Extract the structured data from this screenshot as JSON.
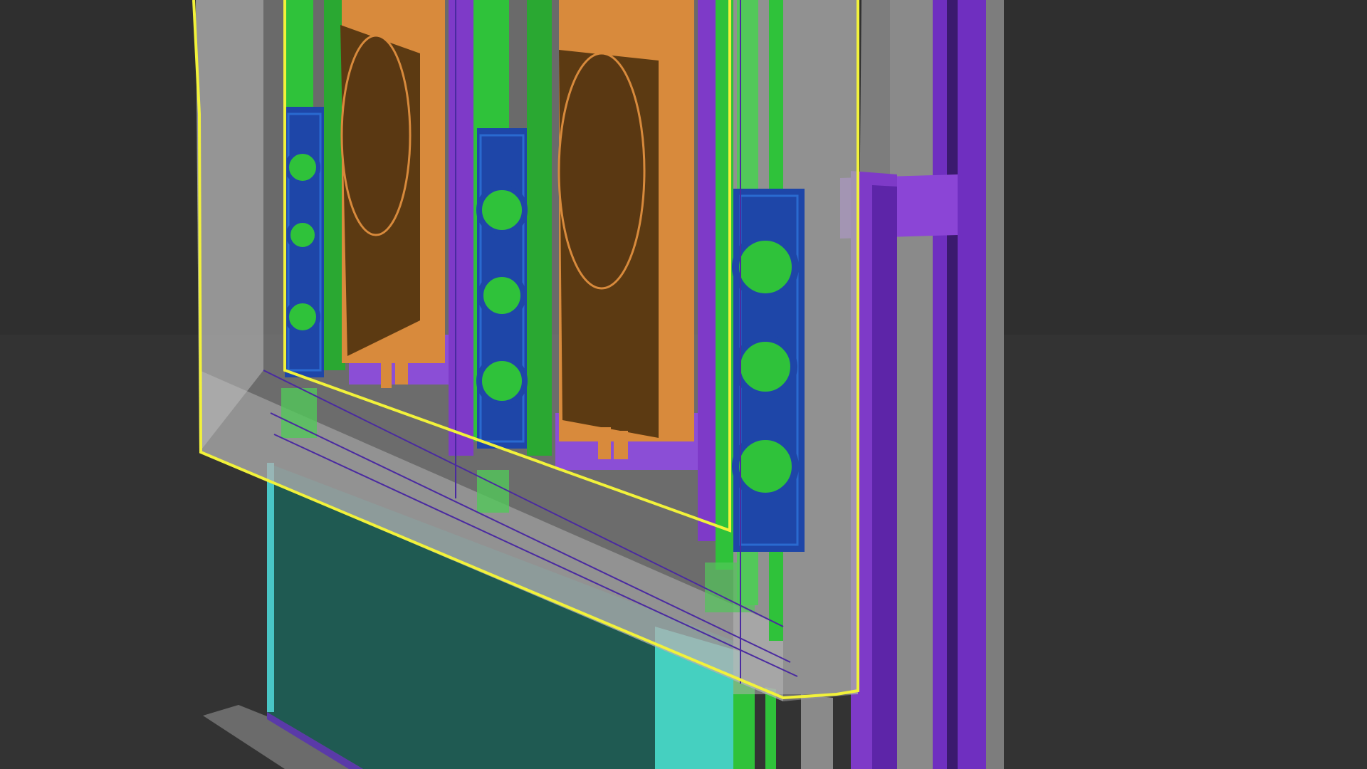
{
  "viewport": {
    "background": "#2e2e2e",
    "colors": {
      "selection_outline": "#f2f23a",
      "purple_frame": "#7e3ac8",
      "green_rail": "#2fc23a",
      "orange_panel": "#d88a3c",
      "brown_panel": "#5c3a12",
      "blue_speaker": "#1e46a8",
      "teal_base": "#1f5a52",
      "cyan_block": "#45d0c0",
      "gray_shell": "#8a8a8a",
      "floor_slab": "#6e6e6e"
    },
    "objects": [
      {
        "name": "selected-enclosure",
        "selected": true
      },
      {
        "name": "subwoofer-left",
        "selected": false
      },
      {
        "name": "subwoofer-right",
        "selected": false
      },
      {
        "name": "speaker-column-left",
        "selected": false
      },
      {
        "name": "speaker-column-center",
        "selected": false
      },
      {
        "name": "speaker-column-right",
        "selected": false
      },
      {
        "name": "teal-base-cabinet",
        "selected": false
      },
      {
        "name": "purple-wall-frame",
        "selected": false
      }
    ]
  }
}
